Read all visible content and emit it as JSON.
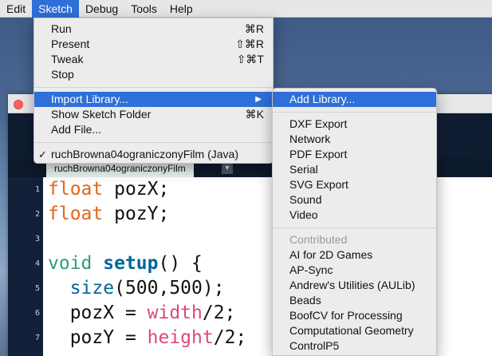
{
  "menubar": {
    "items": [
      "Edit",
      "Sketch",
      "Debug",
      "Tools",
      "Help"
    ],
    "active_index": 1
  },
  "sketch_menu": {
    "items": [
      {
        "label": "Run",
        "shortcut": "⌘R"
      },
      {
        "label": "Present",
        "shortcut": "⇧⌘R"
      },
      {
        "label": "Tweak",
        "shortcut": "⇧⌘T"
      },
      {
        "label": "Stop",
        "shortcut": ""
      },
      {
        "label": "Import Library...",
        "shortcut": ""
      },
      {
        "label": "Show Sketch Folder",
        "shortcut": "⌘K"
      },
      {
        "label": "Add File...",
        "shortcut": ""
      },
      {
        "label": "ruchBrowna04ograniczonyFilm (Java)",
        "shortcut": ""
      }
    ],
    "submenu_arrow": "▶",
    "check": "✓"
  },
  "library_menu": {
    "add_library": "Add Library...",
    "core": [
      "DXF Export",
      "Network",
      "PDF Export",
      "Serial",
      "SVG Export",
      "Sound",
      "Video"
    ],
    "contributed_header": "Contributed",
    "contributed": [
      "AI for 2D Games",
      "AP-Sync",
      "Andrew's Utilities (AULib)",
      "Beads",
      "BoofCV for Processing",
      "Computational Geometry",
      "ControlP5"
    ]
  },
  "editor": {
    "tab_name": "ruchBrowna04ograniczonyFilm",
    "tab_arrow": "▼",
    "line_numbers": [
      "1",
      "2",
      "3",
      "4",
      "5",
      "6",
      "7"
    ],
    "code": {
      "l1_type": "float",
      "l1_rest": " pozX;",
      "l2_type": "float",
      "l2_rest": " pozY;",
      "l4_type": "void",
      "l4_space": " ",
      "l4_fn": "setup",
      "l4_rest": "() {",
      "l5_indent": "  ",
      "l5_fn": "size",
      "l5_rest": "(500,500);",
      "l6_indent": "  ",
      "l6_a": "pozX = ",
      "l6_kw": "width",
      "l6_rest": "/2;",
      "l7_indent": "  ",
      "l7_a": "pozY = ",
      "l7_kw": "height",
      "l7_rest": "/2;"
    }
  },
  "colors": {
    "menu_highlight": "#2f6fd8",
    "keyword_type": "#e2661a",
    "keyword_void": "#33997e",
    "function": "#006699",
    "builtin_var": "#d94a7a"
  }
}
